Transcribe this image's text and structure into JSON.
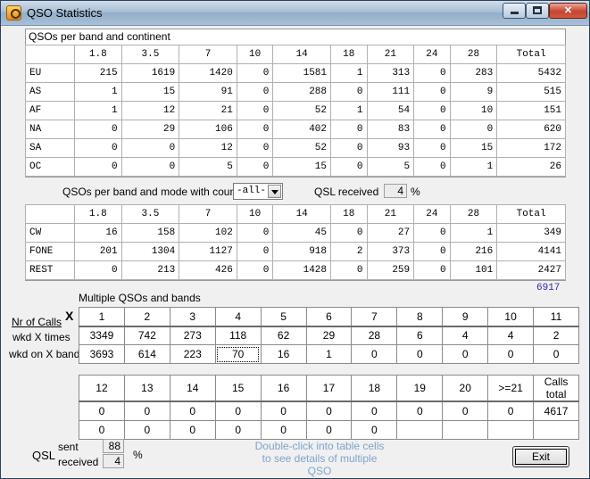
{
  "window": {
    "title": "QSO Statistics"
  },
  "continent_table": {
    "caption": "QSOs per band and continent",
    "headers": [
      "1.8",
      "3.5",
      "7",
      "10",
      "14",
      "18",
      "21",
      "24",
      "28",
      "Total"
    ],
    "rows": [
      {
        "label": "EU",
        "values": [
          "215",
          "1619",
          "1420",
          "0",
          "1581",
          "1",
          "313",
          "0",
          "283",
          "5432"
        ]
      },
      {
        "label": "AS",
        "values": [
          "1",
          "15",
          "91",
          "0",
          "288",
          "0",
          "111",
          "0",
          "9",
          "515"
        ]
      },
      {
        "label": "AF",
        "values": [
          "1",
          "12",
          "21",
          "0",
          "52",
          "1",
          "54",
          "0",
          "10",
          "151"
        ]
      },
      {
        "label": "NA",
        "values": [
          "0",
          "29",
          "106",
          "0",
          "402",
          "0",
          "83",
          "0",
          "0",
          "620"
        ]
      },
      {
        "label": "SA",
        "values": [
          "0",
          "0",
          "12",
          "0",
          "52",
          "0",
          "93",
          "0",
          "15",
          "172"
        ]
      },
      {
        "label": "OC",
        "values": [
          "0",
          "0",
          "5",
          "0",
          "15",
          "0",
          "5",
          "0",
          "1",
          "26"
        ]
      }
    ]
  },
  "mode_filter": {
    "label": "QSOs per band and mode with country",
    "selected": "-all-",
    "qsl_label": "QSL received",
    "qsl_value": "4",
    "qsl_unit": "%"
  },
  "mode_table": {
    "headers": [
      "1.8",
      "3.5",
      "7",
      "10",
      "14",
      "18",
      "21",
      "24",
      "28",
      "Total"
    ],
    "rows": [
      {
        "label": "CW",
        "values": [
          "16",
          "158",
          "102",
          "0",
          "45",
          "0",
          "27",
          "0",
          "1",
          "349"
        ]
      },
      {
        "label": "FONE",
        "values": [
          "201",
          "1304",
          "1127",
          "0",
          "918",
          "2",
          "373",
          "0",
          "216",
          "4141"
        ]
      },
      {
        "label": "REST",
        "values": [
          "0",
          "213",
          "426",
          "0",
          "1428",
          "0",
          "259",
          "0",
          "101",
          "2427"
        ]
      }
    ],
    "grand_total": "6917"
  },
  "multiple": {
    "caption": "Multiple QSOs and bands",
    "nr_label": "Nr of Calls",
    "x_label": "X",
    "times_label": "wkd X times",
    "bands_label": "wkd on X bands",
    "table1": {
      "headers": [
        "1",
        "2",
        "3",
        "4",
        "5",
        "6",
        "7",
        "8",
        "9",
        "10",
        "11"
      ],
      "times": [
        "3349",
        "742",
        "273",
        "118",
        "62",
        "29",
        "28",
        "6",
        "4",
        "4",
        "2"
      ],
      "bands": [
        "3693",
        "614",
        "223",
        "70",
        "16",
        "1",
        "0",
        "0",
        "0",
        "0",
        "0"
      ]
    },
    "table2": {
      "headers": [
        "12",
        "13",
        "14",
        "15",
        "16",
        "17",
        "18",
        "19",
        "20",
        ">=21",
        "Calls total"
      ],
      "times": [
        "0",
        "0",
        "0",
        "0",
        "0",
        "0",
        "0",
        "0",
        "0",
        "0",
        "4617"
      ],
      "bands": [
        "0",
        "0",
        "0",
        "0",
        "0",
        "0",
        "0",
        "",
        "",
        "",
        ""
      ]
    }
  },
  "qsl": {
    "label": "QSL",
    "sent_label": "sent",
    "sent_value": "88",
    "received_label": "received",
    "received_value": "4",
    "unit": "%"
  },
  "hint": "Double-click into table cells to see details of multiple QSO",
  "exit_label": "Exit"
}
